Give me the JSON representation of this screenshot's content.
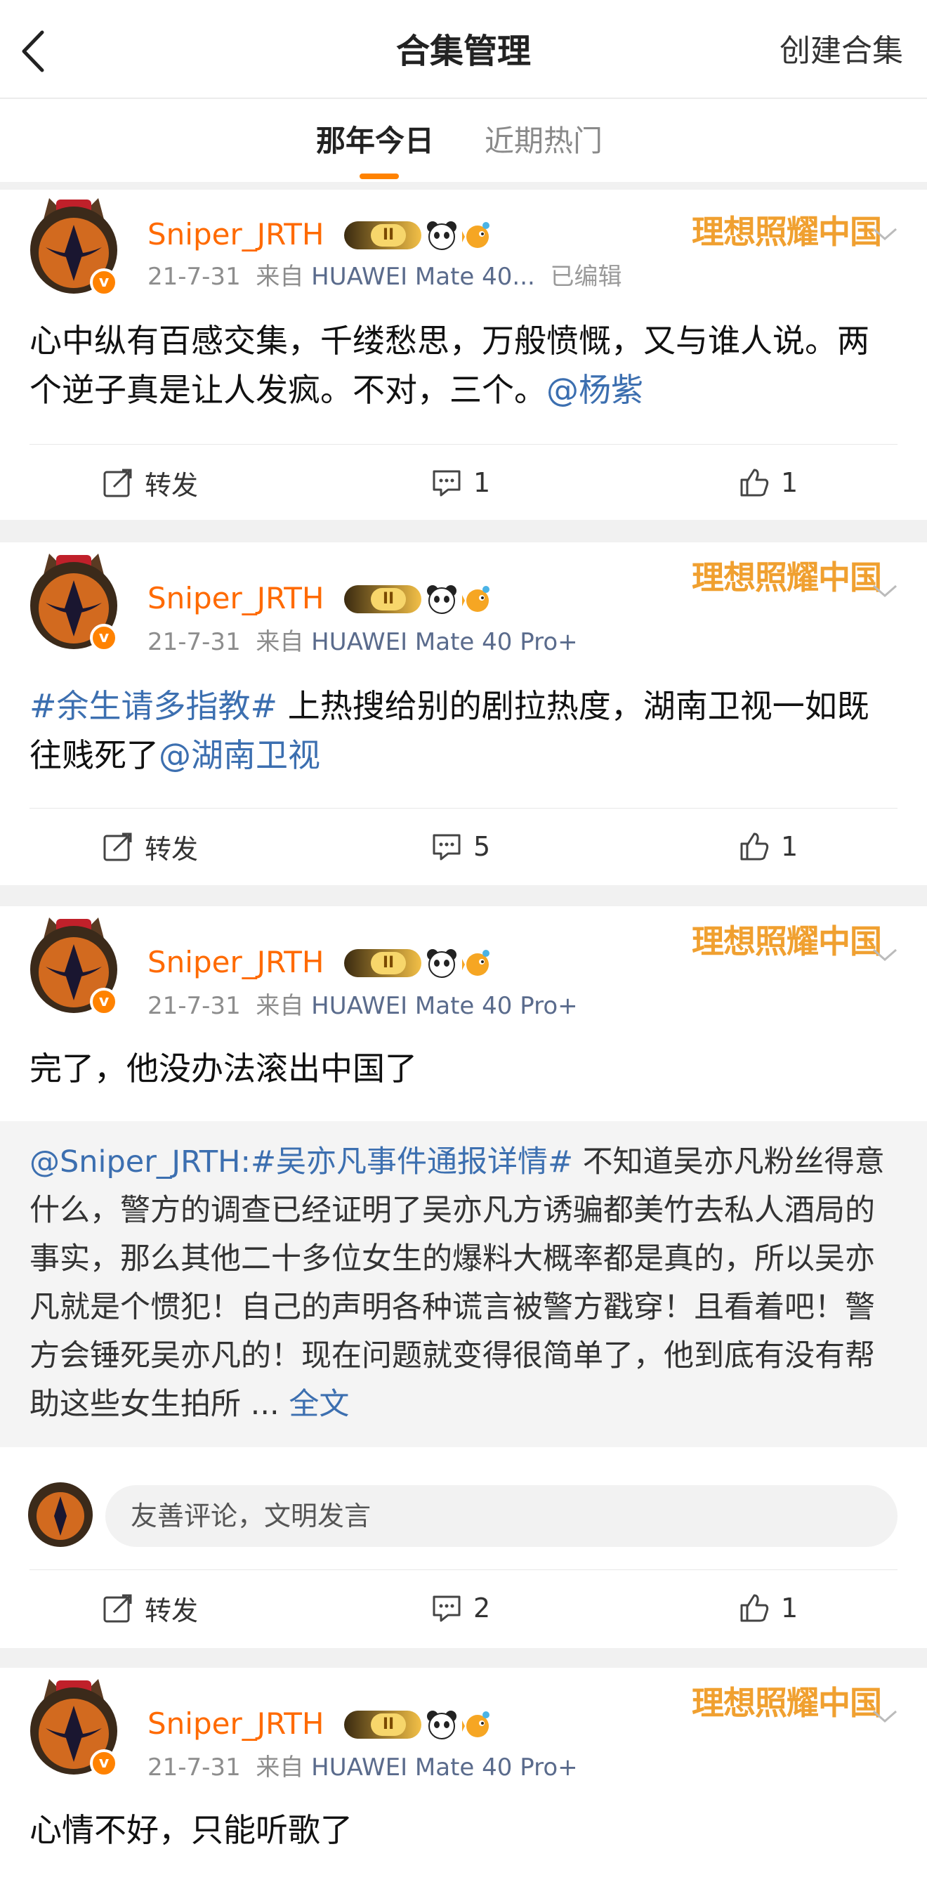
{
  "header": {
    "title": "合集管理",
    "create_label": "创建合集"
  },
  "tabs": [
    {
      "label": "那年今日",
      "active": true
    },
    {
      "label": "近期热门",
      "active": false
    }
  ],
  "colors": {
    "accent": "#ff8200",
    "username": "#ff6a00",
    "link": "#3c6fb0",
    "brand": "#f0a030"
  },
  "icons": {
    "back": "chevron-left-icon",
    "forward": "share-icon",
    "comment": "comment-icon",
    "like": "thumb-up-icon"
  },
  "posts": [
    {
      "username": "Sniper_JRTH",
      "crown_level": "II",
      "brand": "理想照耀中国",
      "date": "21-7-31",
      "from_label": "来自",
      "device": "HUAWEI Mate 40...",
      "edited": "已编辑",
      "text": "心中纵有百感交集，千缕愁思，万般愤慨，又与谁人说。两个逆子真是让人发疯。不对，三个。",
      "mention": "@杨紫",
      "forward_label": "转发",
      "comments": "1",
      "likes": "1"
    },
    {
      "username": "Sniper_JRTH",
      "crown_level": "II",
      "brand": "理想照耀中国",
      "date": "21-7-31",
      "from_label": "来自",
      "device": "HUAWEI Mate 40 Pro+",
      "hashtag": "#余生请多指教#",
      "text": " 上热搜给别的剧拉热度，湖南卫视一如既往贱死了",
      "mention": "@湖南卫视",
      "forward_label": "转发",
      "comments": "5",
      "likes": "1"
    },
    {
      "username": "Sniper_JRTH",
      "crown_level": "II",
      "brand": "理想照耀中国",
      "date": "21-7-31",
      "from_label": "来自",
      "device": "HUAWEI Mate 40 Pro+",
      "text": "完了，他没办法滚出中国了",
      "repost": {
        "author": "@Sniper_JRTH:",
        "hashtag": "#吴亦凡事件通报详情#",
        "text": " 不知道吴亦凡粉丝得意什么，警方的调查已经证明了吴亦凡方诱骗都美竹去私人酒局的事实，那么其他二十多位女生的爆料大概率都是真的，所以吴亦凡就是个惯犯！自己的声明各种谎言被警方戳穿！且看着吧！警方会锤死吴亦凡的！现在问题就变得很简单了，他到底有没有帮助这些女生拍所 ...",
        "full_label": "全文"
      },
      "comment_placeholder": "友善评论，文明发言",
      "forward_label": "转发",
      "comments": "2",
      "likes": "1"
    },
    {
      "username": "Sniper_JRTH",
      "crown_level": "II",
      "brand": "理想照耀中国",
      "date": "21-7-31",
      "from_label": "来自",
      "device": "HUAWEI Mate 40 Pro+",
      "text": "心情不好，只能听歌了"
    }
  ]
}
